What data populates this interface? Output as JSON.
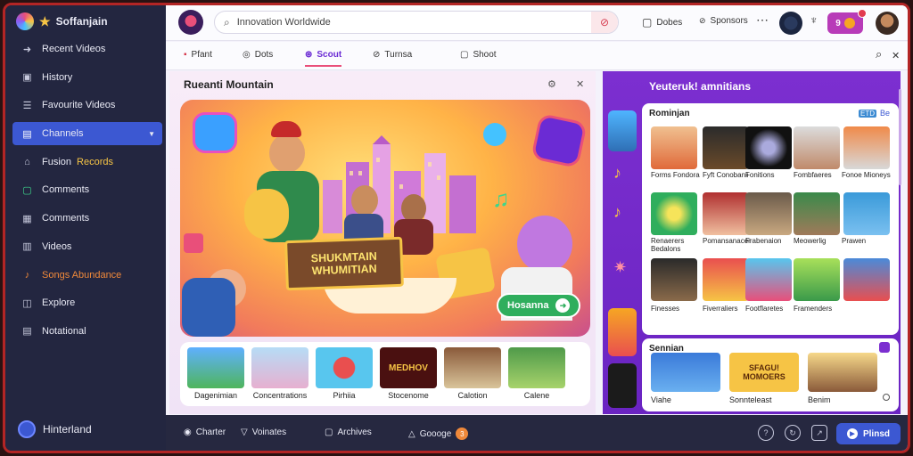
{
  "app": {
    "name": "Soffanjain"
  },
  "sidebar": {
    "items": [
      {
        "label": "Recent Videos",
        "icon": "pin-icon"
      },
      {
        "label": "History",
        "icon": "history-icon"
      },
      {
        "label": "Favourite Videos",
        "icon": "list-icon"
      },
      {
        "label": "Channels",
        "icon": "folder-icon",
        "active": true
      },
      {
        "label": "Fusion",
        "extra": "Records",
        "icon": "bookmark-icon"
      },
      {
        "label": "Comments",
        "icon": "comment-icon"
      },
      {
        "label": "Comments",
        "icon": "grid-icon"
      },
      {
        "label": "Videos",
        "icon": "video-icon"
      },
      {
        "label": "Songs Abundance",
        "icon": "music-icon",
        "highlight": true
      },
      {
        "label": "Explore",
        "icon": "compass-icon"
      },
      {
        "label": "Notational",
        "icon": "note-icon"
      }
    ],
    "user": "Hinterland"
  },
  "topbar": {
    "search_value": "Innovation Worldwide",
    "settings_label": "Dobes",
    "sponsors_label": "Sponsors",
    "notif_count": "9"
  },
  "tabs": [
    {
      "label": "Pfant",
      "icon": "fire-icon"
    },
    {
      "label": "Dots",
      "icon": "circle-icon"
    },
    {
      "label": "Scout",
      "icon": "compass-icon",
      "active": true
    },
    {
      "label": "Turnsa",
      "icon": "tag-icon"
    },
    {
      "label": "Shoot",
      "icon": "square-icon"
    }
  ],
  "left_panel": {
    "title": "Rueanti Mountain",
    "hero": {
      "title_line1": "SHUKMTAIN",
      "title_line2": "WHUMITIAN",
      "button_label": "Hosanna"
    },
    "strip": [
      {
        "label": "Dagenimian"
      },
      {
        "label": "Concentrations"
      },
      {
        "label": "Pirhiia"
      },
      {
        "label": "Stocenome",
        "overlay": "MEDHOV"
      },
      {
        "label": "Calotion"
      },
      {
        "label": "Calene"
      }
    ]
  },
  "right_panel": {
    "title": "Yeuteruk! amnitians",
    "card_title": "Rominjan",
    "card_badge": "ETD",
    "card_ctrl": "Be",
    "grid": [
      {
        "label": "Forms Fondora"
      },
      {
        "label": "Fyft Conobanii"
      },
      {
        "label": "Fonitions"
      },
      {
        "label": "Fombfaeres"
      },
      {
        "label": "Fonoe Mioneys"
      },
      {
        "label": "Renaerers Bedalons"
      },
      {
        "label": "Pomansanacer"
      },
      {
        "label": "Frabenaion"
      },
      {
        "label": "Meowerlig"
      },
      {
        "label": "Prawen"
      },
      {
        "label": "Finesses"
      },
      {
        "label": "Fiverraliers"
      },
      {
        "label": "Footflaretes"
      },
      {
        "label": "Framenders"
      },
      {
        "label": ""
      }
    ],
    "card2_title": "Sennian",
    "card2_items": [
      {
        "label": "Viahe"
      },
      {
        "label": "Sonnteleast",
        "overlay": "SFAGU! MOMOERS"
      },
      {
        "label": "Benim"
      }
    ]
  },
  "bottombar": {
    "items": [
      {
        "label": "Charter",
        "icon": "chat-icon"
      },
      {
        "label": "Voinates",
        "icon": "filter-icon"
      },
      {
        "label": "Archives",
        "icon": "box-icon"
      },
      {
        "label": "Goooge",
        "icon": "triangle-icon",
        "count": "3"
      }
    ],
    "primary_label": "Plinsd"
  }
}
